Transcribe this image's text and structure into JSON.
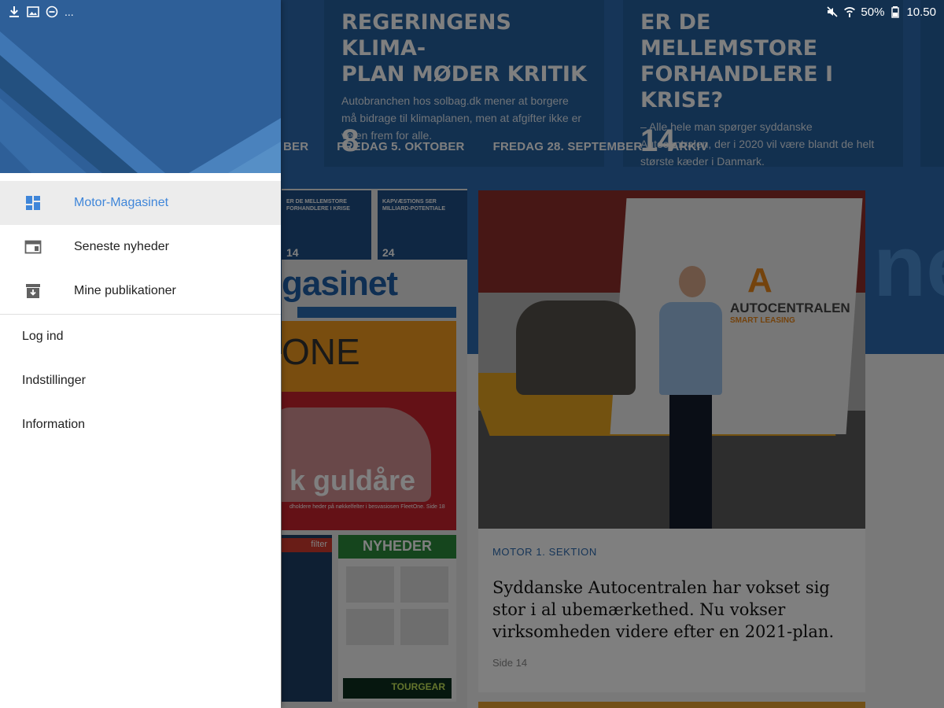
{
  "status_bar": {
    "left_icons": [
      "download-icon",
      "image-icon",
      "do-not-disturb-icon"
    ],
    "overflow": "...",
    "battery": "50%",
    "time": "10.50"
  },
  "background": {
    "hero_cards": [
      {
        "headline_1": "REGERINGENS KLIMA-",
        "headline_2": "PLAN MØDER KRITIK",
        "body": "Autobranchen hos solbag.dk mener at borgere må bidrage til klimaplanen, men at afgifter ikke er vejen frem for alle.",
        "number": "8"
      },
      {
        "headline_1": "ER DE MELLEMSTORE",
        "headline_2": "FORHANDLERE I KRISE?",
        "body": "– Alle hele man spørger syddanske Autocentralen, der i 2020 vil være blandt de helt største kæder i Danmark.",
        "number": "14"
      }
    ],
    "date_tabs": [
      "BER",
      "FREDAG 5. OKTOBER",
      "FREDAG 28. SEPTEMBER",
      "ARKIV"
    ],
    "bg_word": "ne",
    "paper": {
      "mini_cards": [
        {
          "head": "ER DE MELLEMSTORE FORHANDLERE I KRISE",
          "num": "14"
        },
        {
          "head": "KAPVÆSTIONS SER MILLIARD-POTENTIALE",
          "num": "24"
        }
      ],
      "masthead": "gasinet",
      "cover_word": "ONE",
      "cover_headline": "k guldåre",
      "cover_sub": "dholdere heder på nøkkelfelter i besvasiosen FleetOne. Side 18",
      "filter_label": "filter",
      "news_label": "NYHEDER",
      "tour_label": "TOURGEAR"
    },
    "article": {
      "category": "MOTOR 1. SEKTION",
      "title": "Syddanske Autocentralen har vokset sig stor i al ubemærkethed. Nu vokser virksomheden videre efter en 2021-plan.",
      "page": "Side 14",
      "photo_logo_top": "AUTOCENTRALEN",
      "photo_logo_sub": "SMART LEASING"
    }
  },
  "drawer": {
    "nav_items": [
      {
        "label": "Motor-Magasinet",
        "icon": "dashboard-icon",
        "active": true
      },
      {
        "label": "Seneste nyheder",
        "icon": "web-window-icon",
        "active": false
      },
      {
        "label": "Mine publikationer",
        "icon": "archive-download-icon",
        "active": false
      }
    ],
    "secondary_items": [
      {
        "label": "Log ind"
      },
      {
        "label": "Indstillinger"
      },
      {
        "label": "Information"
      }
    ]
  },
  "colors": {
    "accent": "#3f86d9",
    "header_blue": "#2c5f9a",
    "hero_blue": "#2d6bb0"
  }
}
